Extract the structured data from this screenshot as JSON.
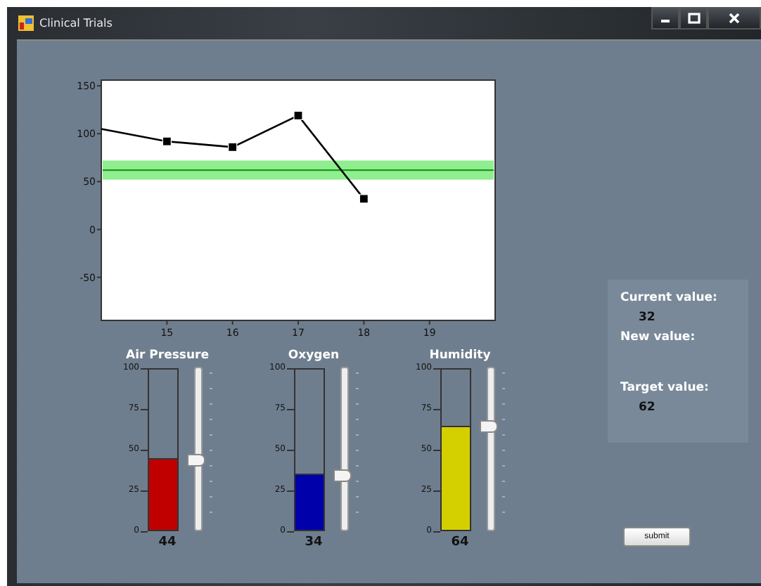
{
  "window": {
    "title": "Clinical Trials"
  },
  "chart": {
    "chart_data": {
      "type": "line",
      "x": [
        14,
        15,
        16,
        17,
        18
      ],
      "series": [
        {
          "color": "#000000",
          "marker": "square",
          "values": [
            105,
            92,
            86,
            119,
            32
          ]
        }
      ],
      "xlim": [
        14,
        20
      ],
      "ylim": [
        -95,
        156
      ],
      "xticks": [
        15,
        16,
        17,
        18,
        19
      ],
      "yticks": [
        -50,
        0,
        50,
        100,
        150
      ],
      "bands": [
        {
          "axis": "y",
          "from": 52,
          "to": 72,
          "color": "#90ee90"
        }
      ],
      "ref_lines": [
        {
          "axis": "y",
          "value": 62,
          "color": "#1a9a1a"
        }
      ]
    }
  },
  "gauges": [
    {
      "label": "Air Pressure",
      "level": 0.44,
      "value": "44",
      "color": "#c00000",
      "scale": [
        "100",
        "75",
        "50",
        "25",
        "0"
      ]
    },
    {
      "label": "Oxygen",
      "level": 0.34,
      "value": "34",
      "color": "#0000aa",
      "scale": [
        "100",
        "75",
        "50",
        "25",
        "0"
      ]
    },
    {
      "label": "Humidity",
      "level": 0.64,
      "value": "64",
      "color": "#d4d000",
      "scale": [
        "100",
        "75",
        "50",
        "25",
        "0"
      ]
    }
  ],
  "info": {
    "current_label": "Current value:",
    "current_value": "32",
    "new_label": "New value:",
    "target_label": "Target value:",
    "target_value": "62"
  },
  "submit_button": "submit"
}
